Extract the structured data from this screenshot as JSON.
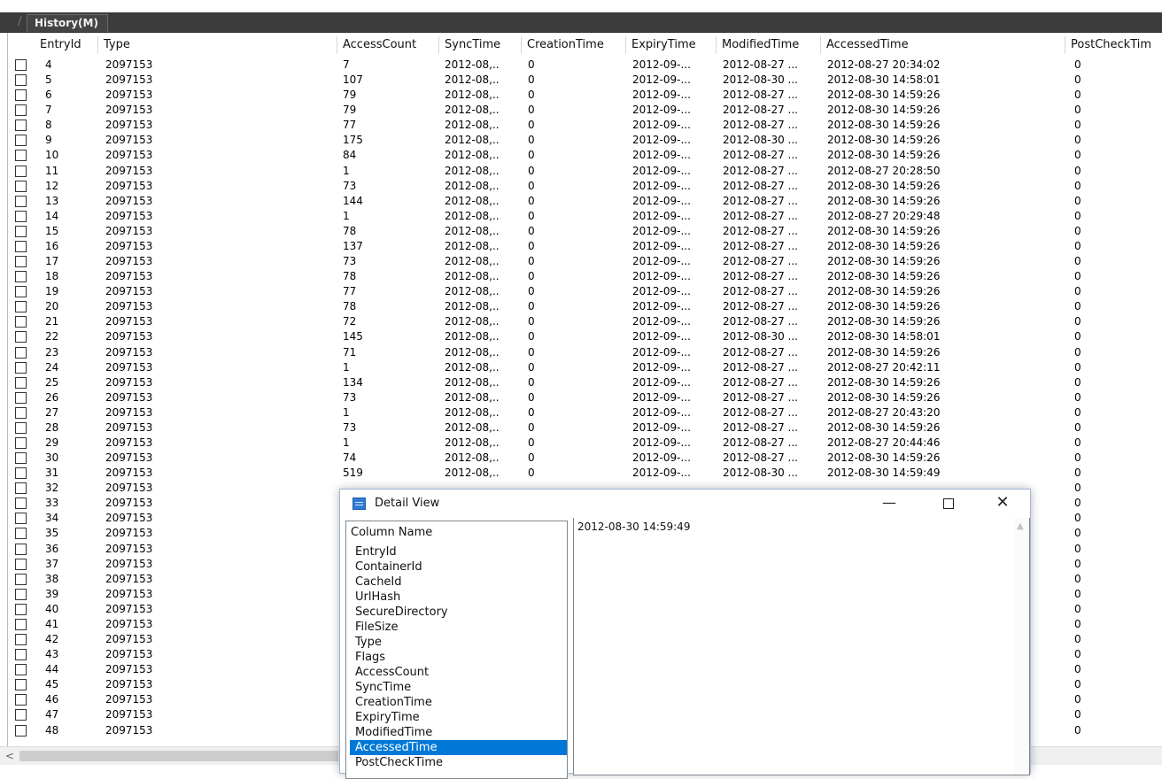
{
  "window": {
    "tab_label": "History(M)"
  },
  "table": {
    "columns": [
      "EntryId",
      "Type",
      "AccessCount",
      "SyncTime",
      "CreationTime",
      "ExpiryTime",
      "ModifiedTime",
      "AccessedTime",
      "PostCheckTim"
    ],
    "rows": [
      {
        "id": "4",
        "type": "2097153",
        "access": "7",
        "sync": "2012-08,..",
        "creation": "0",
        "expiry": "2012-09-...",
        "modified": "2012-08-27 ...",
        "accessed": "2012-08-27 20:34:02",
        "postcheck": "0"
      },
      {
        "id": "5",
        "type": "2097153",
        "access": "107",
        "sync": "2012-08,..",
        "creation": "0",
        "expiry": "2012-09-...",
        "modified": "2012-08-30 ...",
        "accessed": "2012-08-30 14:58:01",
        "postcheck": "0"
      },
      {
        "id": "6",
        "type": "2097153",
        "access": "79",
        "sync": "2012-08,..",
        "creation": "0",
        "expiry": "2012-09-...",
        "modified": "2012-08-27 ...",
        "accessed": "2012-08-30 14:59:26",
        "postcheck": "0"
      },
      {
        "id": "7",
        "type": "2097153",
        "access": "79",
        "sync": "2012-08,..",
        "creation": "0",
        "expiry": "2012-09-...",
        "modified": "2012-08-27 ...",
        "accessed": "2012-08-30 14:59:26",
        "postcheck": "0"
      },
      {
        "id": "8",
        "type": "2097153",
        "access": "77",
        "sync": "2012-08,..",
        "creation": "0",
        "expiry": "2012-09-...",
        "modified": "2012-08-27 ...",
        "accessed": "2012-08-30 14:59:26",
        "postcheck": "0"
      },
      {
        "id": "9",
        "type": "2097153",
        "access": "175",
        "sync": "2012-08,..",
        "creation": "0",
        "expiry": "2012-09-...",
        "modified": "2012-08-30 ...",
        "accessed": "2012-08-30 14:59:26",
        "postcheck": "0"
      },
      {
        "id": "10",
        "type": "2097153",
        "access": "84",
        "sync": "2012-08,..",
        "creation": "0",
        "expiry": "2012-09-...",
        "modified": "2012-08-27 ...",
        "accessed": "2012-08-30 14:59:26",
        "postcheck": "0"
      },
      {
        "id": "11",
        "type": "2097153",
        "access": "1",
        "sync": "2012-08,..",
        "creation": "0",
        "expiry": "2012-09-...",
        "modified": "2012-08-27 ...",
        "accessed": "2012-08-27 20:28:50",
        "postcheck": "0"
      },
      {
        "id": "12",
        "type": "2097153",
        "access": "73",
        "sync": "2012-08,..",
        "creation": "0",
        "expiry": "2012-09-...",
        "modified": "2012-08-27 ...",
        "accessed": "2012-08-30 14:59:26",
        "postcheck": "0"
      },
      {
        "id": "13",
        "type": "2097153",
        "access": "144",
        "sync": "2012-08,..",
        "creation": "0",
        "expiry": "2012-09-...",
        "modified": "2012-08-27 ...",
        "accessed": "2012-08-30 14:59:26",
        "postcheck": "0"
      },
      {
        "id": "14",
        "type": "2097153",
        "access": "1",
        "sync": "2012-08,..",
        "creation": "0",
        "expiry": "2012-09-...",
        "modified": "2012-08-27 ...",
        "accessed": "2012-08-27 20:29:48",
        "postcheck": "0"
      },
      {
        "id": "15",
        "type": "2097153",
        "access": "78",
        "sync": "2012-08,..",
        "creation": "0",
        "expiry": "2012-09-...",
        "modified": "2012-08-27 ...",
        "accessed": "2012-08-30 14:59:26",
        "postcheck": "0"
      },
      {
        "id": "16",
        "type": "2097153",
        "access": "137",
        "sync": "2012-08,..",
        "creation": "0",
        "expiry": "2012-09-...",
        "modified": "2012-08-27 ...",
        "accessed": "2012-08-30 14:59:26",
        "postcheck": "0"
      },
      {
        "id": "17",
        "type": "2097153",
        "access": "73",
        "sync": "2012-08,..",
        "creation": "0",
        "expiry": "2012-09-...",
        "modified": "2012-08-27 ...",
        "accessed": "2012-08-30 14:59:26",
        "postcheck": "0"
      },
      {
        "id": "18",
        "type": "2097153",
        "access": "78",
        "sync": "2012-08,..",
        "creation": "0",
        "expiry": "2012-09-...",
        "modified": "2012-08-27 ...",
        "accessed": "2012-08-30 14:59:26",
        "postcheck": "0"
      },
      {
        "id": "19",
        "type": "2097153",
        "access": "77",
        "sync": "2012-08,..",
        "creation": "0",
        "expiry": "2012-09-...",
        "modified": "2012-08-27 ...",
        "accessed": "2012-08-30 14:59:26",
        "postcheck": "0"
      },
      {
        "id": "20",
        "type": "2097153",
        "access": "78",
        "sync": "2012-08,..",
        "creation": "0",
        "expiry": "2012-09-...",
        "modified": "2012-08-27 ...",
        "accessed": "2012-08-30 14:59:26",
        "postcheck": "0"
      },
      {
        "id": "21",
        "type": "2097153",
        "access": "72",
        "sync": "2012-08,..",
        "creation": "0",
        "expiry": "2012-09-...",
        "modified": "2012-08-27 ...",
        "accessed": "2012-08-30 14:59:26",
        "postcheck": "0"
      },
      {
        "id": "22",
        "type": "2097153",
        "access": "145",
        "sync": "2012-08,..",
        "creation": "0",
        "expiry": "2012-09-...",
        "modified": "2012-08-30 ...",
        "accessed": "2012-08-30 14:58:01",
        "postcheck": "0"
      },
      {
        "id": "23",
        "type": "2097153",
        "access": "71",
        "sync": "2012-08,..",
        "creation": "0",
        "expiry": "2012-09-...",
        "modified": "2012-08-27 ...",
        "accessed": "2012-08-30 14:59:26",
        "postcheck": "0"
      },
      {
        "id": "24",
        "type": "2097153",
        "access": "1",
        "sync": "2012-08,..",
        "creation": "0",
        "expiry": "2012-09-...",
        "modified": "2012-08-27 ...",
        "accessed": "2012-08-27 20:42:11",
        "postcheck": "0"
      },
      {
        "id": "25",
        "type": "2097153",
        "access": "134",
        "sync": "2012-08,..",
        "creation": "0",
        "expiry": "2012-09-...",
        "modified": "2012-08-27 ...",
        "accessed": "2012-08-30 14:59:26",
        "postcheck": "0"
      },
      {
        "id": "26",
        "type": "2097153",
        "access": "73",
        "sync": "2012-08,..",
        "creation": "0",
        "expiry": "2012-09-...",
        "modified": "2012-08-27 ...",
        "accessed": "2012-08-30 14:59:26",
        "postcheck": "0"
      },
      {
        "id": "27",
        "type": "2097153",
        "access": "1",
        "sync": "2012-08,..",
        "creation": "0",
        "expiry": "2012-09-...",
        "modified": "2012-08-27 ...",
        "accessed": "2012-08-27 20:43:20",
        "postcheck": "0"
      },
      {
        "id": "28",
        "type": "2097153",
        "access": "73",
        "sync": "2012-08,..",
        "creation": "0",
        "expiry": "2012-09-...",
        "modified": "2012-08-27 ...",
        "accessed": "2012-08-30 14:59:26",
        "postcheck": "0"
      },
      {
        "id": "29",
        "type": "2097153",
        "access": "1",
        "sync": "2012-08,..",
        "creation": "0",
        "expiry": "2012-09-...",
        "modified": "2012-08-27 ...",
        "accessed": "2012-08-27 20:44:46",
        "postcheck": "0"
      },
      {
        "id": "30",
        "type": "2097153",
        "access": "74",
        "sync": "2012-08,..",
        "creation": "0",
        "expiry": "2012-09-...",
        "modified": "2012-08-27 ...",
        "accessed": "2012-08-30 14:59:26",
        "postcheck": "0"
      },
      {
        "id": "31",
        "type": "2097153",
        "access": "519",
        "sync": "2012-08,..",
        "creation": "0",
        "expiry": "2012-09-...",
        "modified": "2012-08-30 ...",
        "accessed": "2012-08-30 14:59:49",
        "postcheck": "0"
      },
      {
        "id": "32",
        "type": "2097153",
        "access": "",
        "sync": "",
        "creation": "",
        "expiry": "",
        "modified": "",
        "accessed": "",
        "postcheck": "0"
      },
      {
        "id": "33",
        "type": "2097153",
        "access": "",
        "sync": "",
        "creation": "",
        "expiry": "",
        "modified": "",
        "accessed": "",
        "postcheck": "0"
      },
      {
        "id": "34",
        "type": "2097153",
        "access": "",
        "sync": "",
        "creation": "",
        "expiry": "",
        "modified": "",
        "accessed": "",
        "postcheck": "0"
      },
      {
        "id": "35",
        "type": "2097153",
        "access": "",
        "sync": "",
        "creation": "",
        "expiry": "",
        "modified": "",
        "accessed": "",
        "postcheck": "0"
      },
      {
        "id": "36",
        "type": "2097153",
        "access": "",
        "sync": "",
        "creation": "",
        "expiry": "",
        "modified": "",
        "accessed": "",
        "postcheck": "0"
      },
      {
        "id": "37",
        "type": "2097153",
        "access": "",
        "sync": "",
        "creation": "",
        "expiry": "",
        "modified": "",
        "accessed": "",
        "postcheck": "0"
      },
      {
        "id": "38",
        "type": "2097153",
        "access": "",
        "sync": "",
        "creation": "",
        "expiry": "",
        "modified": "",
        "accessed": "",
        "postcheck": "0"
      },
      {
        "id": "39",
        "type": "2097153",
        "access": "",
        "sync": "",
        "creation": "",
        "expiry": "",
        "modified": "",
        "accessed": "",
        "postcheck": "0"
      },
      {
        "id": "40",
        "type": "2097153",
        "access": "",
        "sync": "",
        "creation": "",
        "expiry": "",
        "modified": "",
        "accessed": "",
        "postcheck": "0"
      },
      {
        "id": "41",
        "type": "2097153",
        "access": "",
        "sync": "",
        "creation": "",
        "expiry": "",
        "modified": "",
        "accessed": "",
        "postcheck": "0"
      },
      {
        "id": "42",
        "type": "2097153",
        "access": "",
        "sync": "",
        "creation": "",
        "expiry": "",
        "modified": "",
        "accessed": "",
        "postcheck": "0"
      },
      {
        "id": "43",
        "type": "2097153",
        "access": "",
        "sync": "",
        "creation": "",
        "expiry": "",
        "modified": "",
        "accessed": "",
        "postcheck": "0"
      },
      {
        "id": "44",
        "type": "2097153",
        "access": "",
        "sync": "",
        "creation": "",
        "expiry": "",
        "modified": "",
        "accessed": "",
        "postcheck": "0"
      },
      {
        "id": "45",
        "type": "2097153",
        "access": "",
        "sync": "",
        "creation": "",
        "expiry": "",
        "modified": "",
        "accessed": "",
        "postcheck": "0"
      },
      {
        "id": "46",
        "type": "2097153",
        "access": "",
        "sync": "",
        "creation": "",
        "expiry": "",
        "modified": "",
        "accessed": "",
        "postcheck": "0"
      },
      {
        "id": "47",
        "type": "2097153",
        "access": "",
        "sync": "",
        "creation": "",
        "expiry": "",
        "modified": "",
        "accessed": "",
        "postcheck": "0"
      },
      {
        "id": "48",
        "type": "2097153",
        "access": "",
        "sync": "",
        "creation": "",
        "expiry": "",
        "modified": "",
        "accessed": "",
        "postcheck": "0"
      }
    ]
  },
  "scrollbar": {
    "left_arrow": "<"
  },
  "detail_view": {
    "title": "Detail View",
    "icon": "window-list-icon",
    "minimize": "—",
    "close": "✕",
    "list_header": "Column Name",
    "columns": [
      "EntryId",
      "ContainerId",
      "CacheId",
      "UrlHash",
      "SecureDirectory",
      "FileSize",
      "Type",
      "Flags",
      "AccessCount",
      "SyncTime",
      "CreationTime",
      "ExpiryTime",
      "ModifiedTime",
      "AccessedTime",
      "PostCheckTime"
    ],
    "selected": "AccessedTime",
    "value": "2012-08-30 14:59:49",
    "scroll_up": "▲"
  },
  "colors": {
    "titlebar": "#3c3c3c",
    "selection": "#0078d7"
  }
}
